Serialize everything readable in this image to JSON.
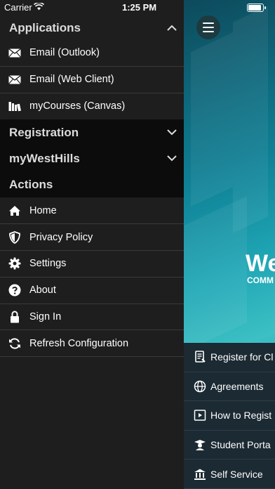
{
  "status_bar": {
    "carrier": "Carrier",
    "time": "1:25 PM"
  },
  "drawer": {
    "sections": [
      {
        "title": "Applications",
        "expanded": true,
        "items": [
          {
            "label": "Email (Outlook)",
            "icon": "envelope-icon"
          },
          {
            "label": "Email (Web Client)",
            "icon": "envelope-icon"
          },
          {
            "label": "myCourses (Canvas)",
            "icon": "books-icon"
          }
        ]
      },
      {
        "title": "Registration",
        "expanded": false
      },
      {
        "title": "myWestHills",
        "expanded": false
      },
      {
        "title": "Actions",
        "items": [
          {
            "label": "Home",
            "icon": "home-icon"
          },
          {
            "label": "Privacy Policy",
            "icon": "shield-icon"
          },
          {
            "label": "Settings",
            "icon": "gear-icon"
          },
          {
            "label": "About",
            "icon": "question-icon"
          },
          {
            "label": "Sign In",
            "icon": "lock-icon"
          },
          {
            "label": "Refresh Configuration",
            "icon": "refresh-icon"
          }
        ]
      }
    ]
  },
  "app": {
    "logo_text": "We",
    "logo_sub": "COMM",
    "list_items": [
      {
        "label": "Register for Cl",
        "icon": "document-icon"
      },
      {
        "label": "Agreements",
        "icon": "globe-icon"
      },
      {
        "label": "How to Regist",
        "icon": "video-icon"
      },
      {
        "label": "Student Porta",
        "icon": "student-icon"
      },
      {
        "label": "Self Service",
        "icon": "bank-icon"
      }
    ]
  },
  "colors": {
    "drawer_bg": "#1e1e1e",
    "section_bg": "#0c0c0c",
    "app_accent": "#1fa6b5"
  }
}
